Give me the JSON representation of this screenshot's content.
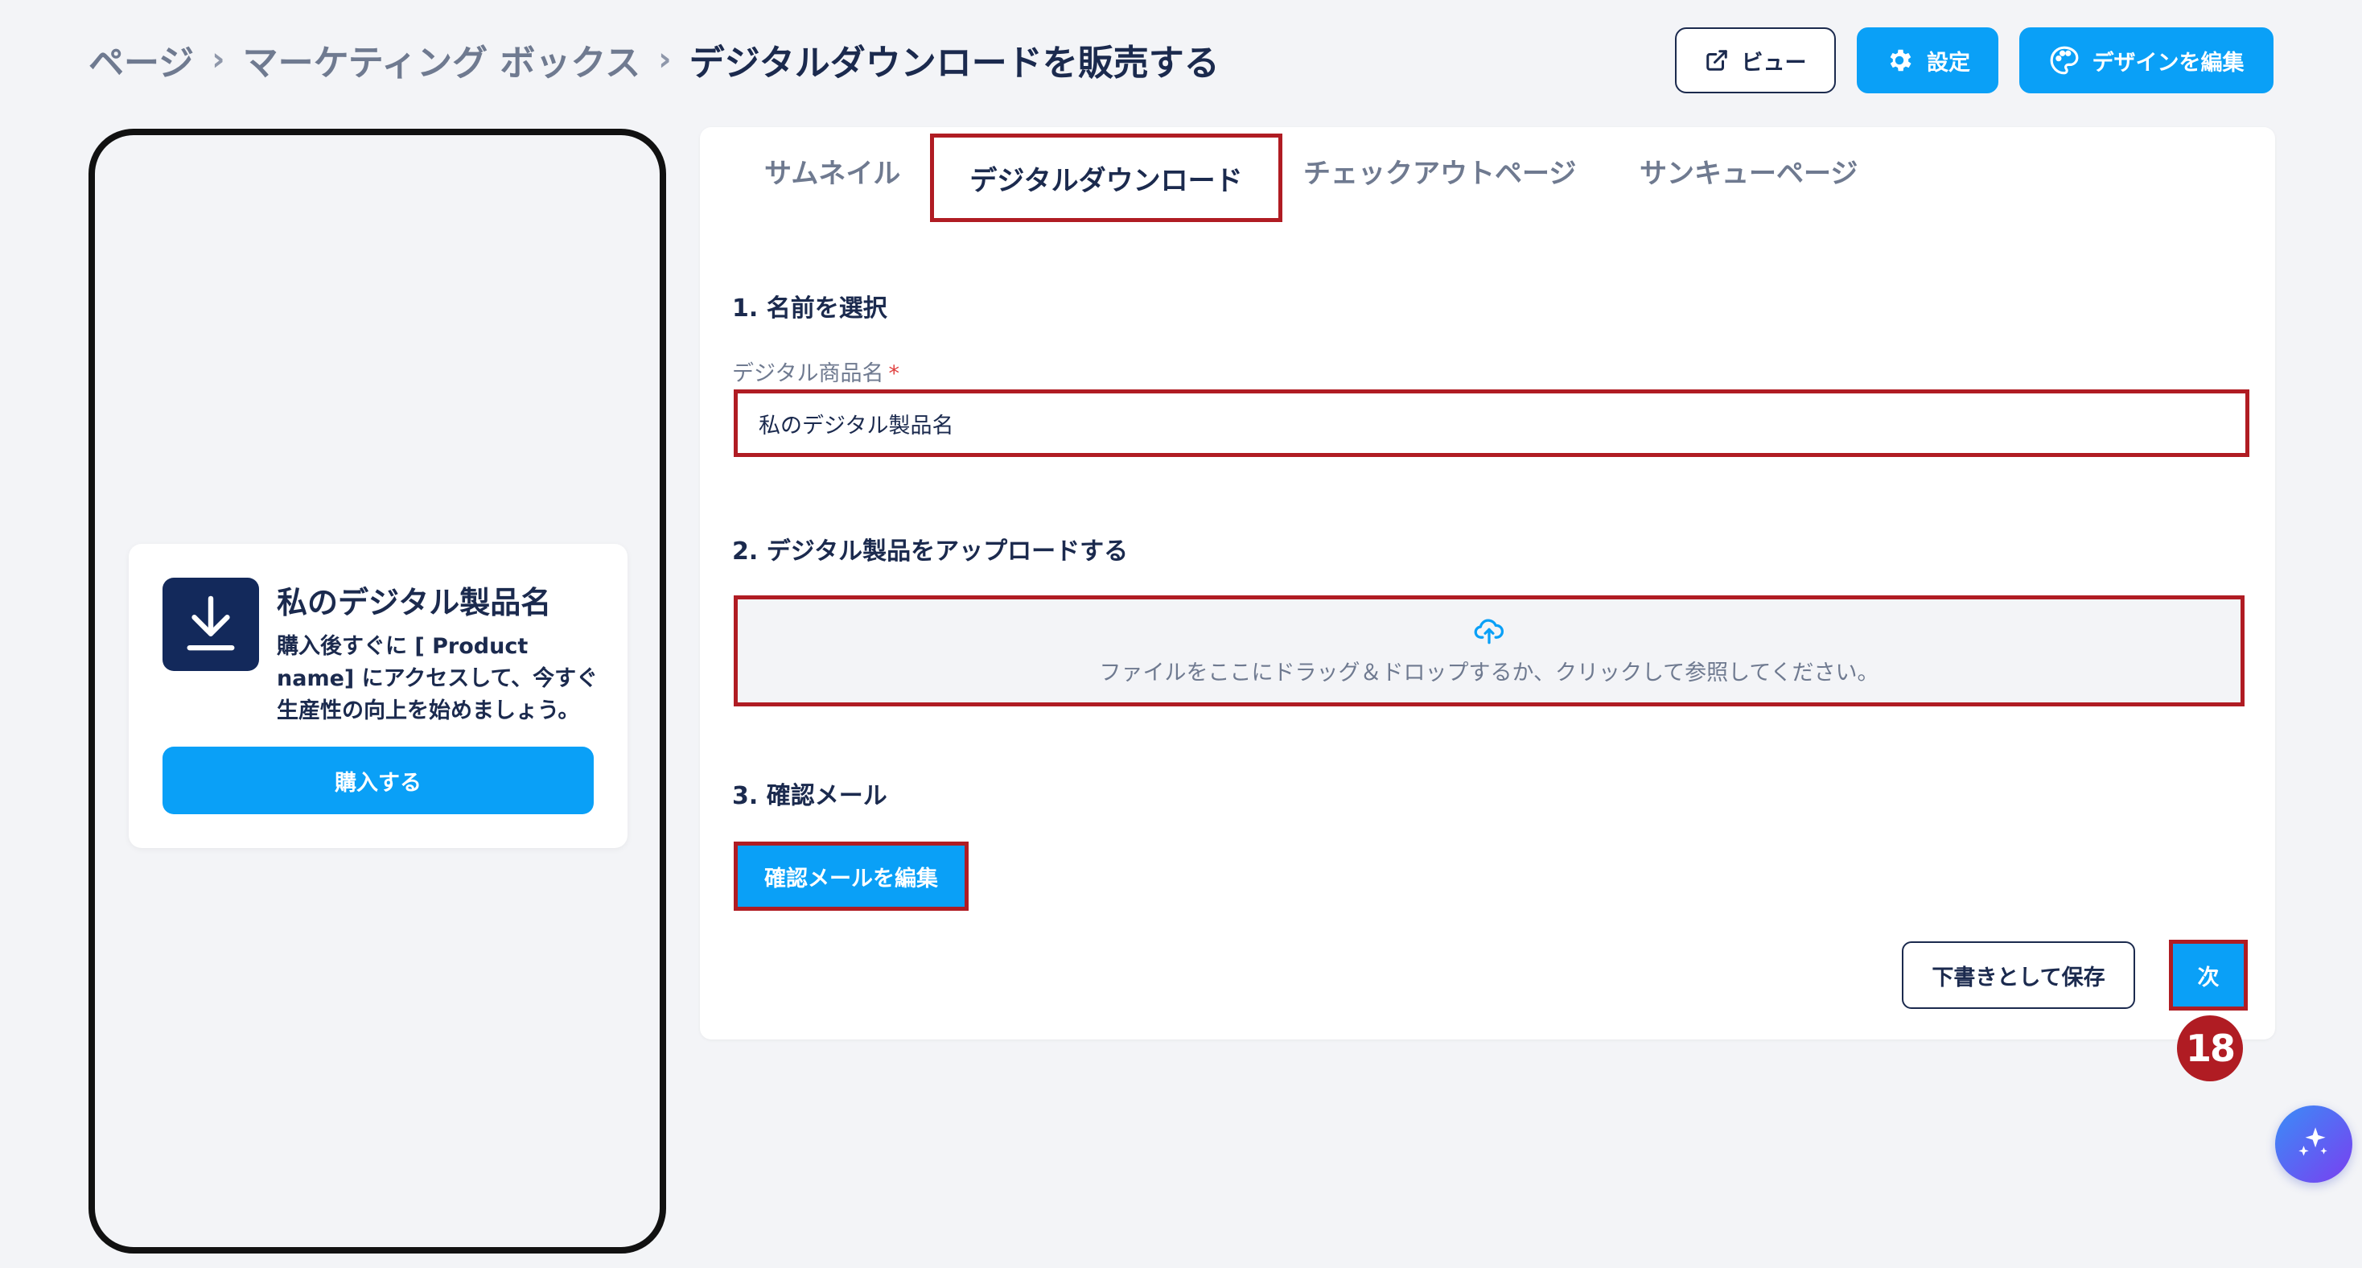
{
  "breadcrumb": {
    "items": [
      "ページ",
      "マーケティング ボックス"
    ],
    "current": "デジタルダウンロードを販売する",
    "separator": "›"
  },
  "header_actions": {
    "view_label": "ビュー",
    "settings_label": "設定",
    "edit_design_label": "デザインを編集"
  },
  "preview": {
    "product_title": "私のデジタル製品名",
    "product_desc": "購入後すぐに [ Product name] にアクセスして、今すぐ生産性の向上を始めましょう。",
    "buy_label": "購入する"
  },
  "tabs": [
    {
      "label": "サムネイル",
      "active": false
    },
    {
      "label": "デジタルダウンロード",
      "active": true
    },
    {
      "label": "チェックアウトページ",
      "active": false
    },
    {
      "label": "サンキューページ",
      "active": false
    }
  ],
  "form": {
    "section1_title": "1. 名前を選択",
    "name_label": "デジタル商品名",
    "required_mark": "*",
    "name_value": "私のデジタル製品名",
    "section2_title": "2. デジタル製品をアップロードする",
    "dropzone_text": "ファイルをここにドラッグ＆ドロップするか、クリックして参照してください。",
    "section3_title": "3. 確認メール",
    "edit_email_label": "確認メールを編集",
    "save_draft_label": "下書きとして保存",
    "next_label": "次"
  },
  "step_badge": "18",
  "colors": {
    "primary": "#0aa0f7",
    "navy": "#1b2a4e",
    "highlight": "#b01c23"
  }
}
